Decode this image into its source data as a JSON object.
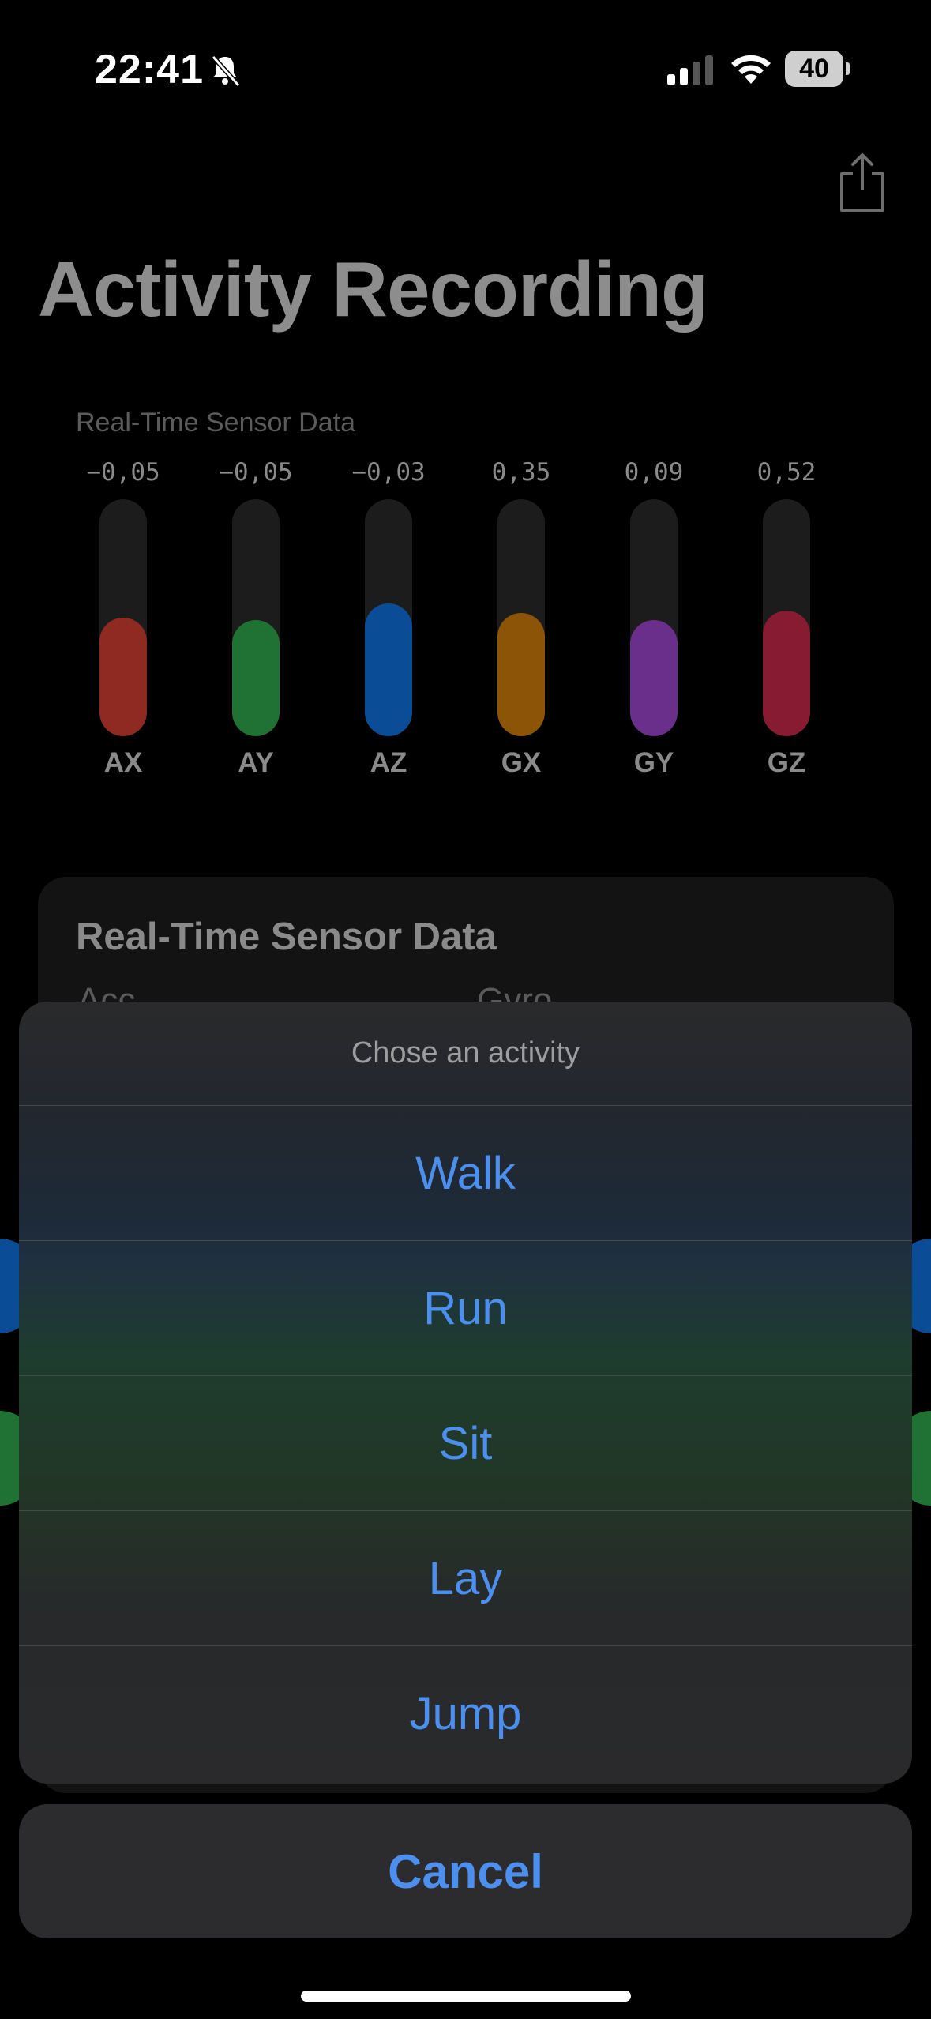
{
  "status_bar": {
    "time": "22:41",
    "battery": "40"
  },
  "header": {
    "title": "Activity Recording"
  },
  "sensor_chart": {
    "title": "Real-Time Sensor Data",
    "bars": [
      {
        "label": "AX",
        "value_text": "−0,05",
        "level": 0.5,
        "color": "#8e2a21"
      },
      {
        "label": "AY",
        "value_text": "−0,05",
        "level": 0.49,
        "color": "#1f7234"
      },
      {
        "label": "AZ",
        "value_text": "−0,03",
        "level": 0.56,
        "color": "#0a4d96"
      },
      {
        "label": "GX",
        "value_text": "0,35",
        "level": 0.52,
        "color": "#8c5406"
      },
      {
        "label": "GY",
        "value_text": "0,09",
        "level": 0.49,
        "color": "#6a2f8a"
      },
      {
        "label": "GZ",
        "value_text": "0,52",
        "level": 0.53,
        "color": "#861b32"
      }
    ]
  },
  "data_card": {
    "title": "Real-Time Sensor Data",
    "col1": "Acc",
    "col2": "Gyro"
  },
  "action_sheet": {
    "title": "Chose an activity",
    "options": [
      "Walk",
      "Run",
      "Sit",
      "Lay",
      "Jump"
    ],
    "cancel_label": "Cancel"
  }
}
